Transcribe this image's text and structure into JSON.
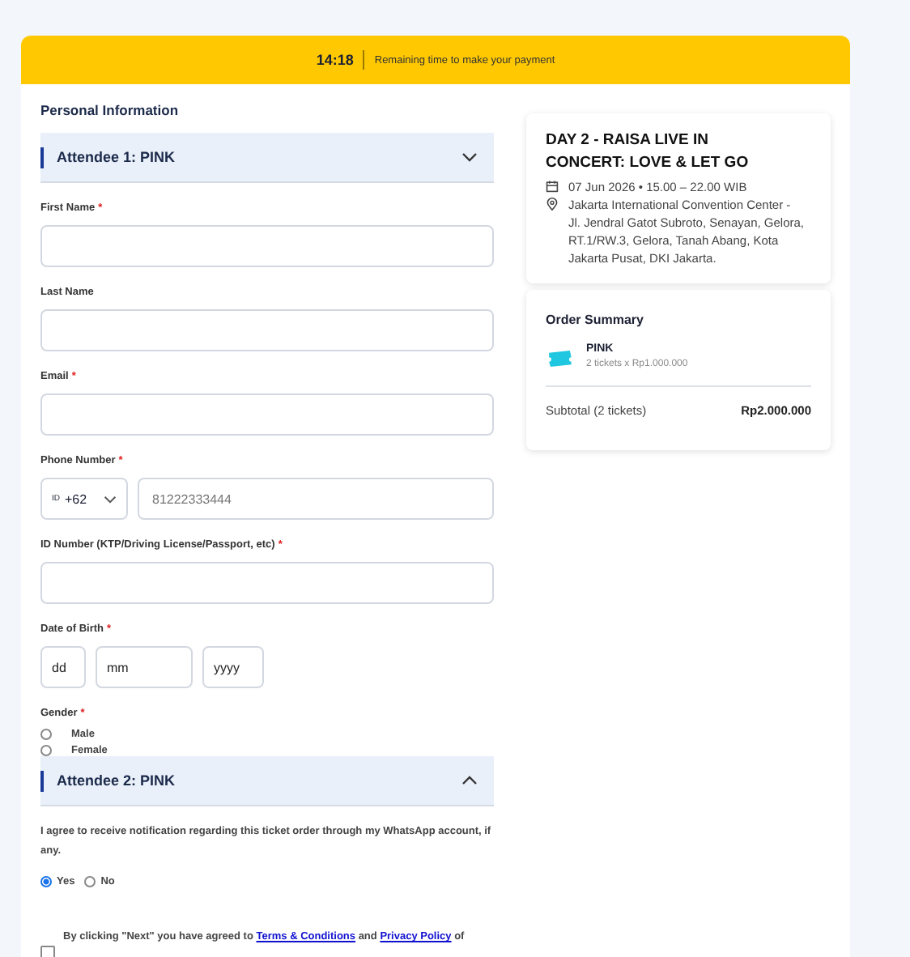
{
  "banner": {
    "timer": "14:18",
    "message": "Remaining time to make your payment"
  },
  "section_title": "Personal Information",
  "attendees": [
    {
      "title": "Attendee 1: PINK",
      "expanded": true
    },
    {
      "title": "Attendee 2: PINK",
      "expanded": false
    }
  ],
  "fields": [
    {
      "kind": "text",
      "label": "First Name",
      "required_mark": "*"
    },
    {
      "kind": "text",
      "label": "Last Name"
    },
    {
      "kind": "text",
      "label": "Email",
      "required_mark": "*"
    },
    {
      "kind": "phone",
      "label": "Phone Number",
      "required_mark": "*",
      "country": "+62",
      "flag": "ID",
      "placeholder": "81222333444"
    },
    {
      "kind": "text",
      "label": "ID Number (KTP/Driving License/Passport, etc)",
      "required_mark": "*"
    },
    {
      "kind": "date",
      "label": "Date of Birth",
      "required_mark": "*",
      "placeholders": [
        "dd",
        "mm",
        "yyyy"
      ]
    },
    {
      "kind": "radio",
      "label": "Gender",
      "required_mark": "*",
      "options": [
        {
          "label": "Male",
          "selected": false
        },
        {
          "label": "Female",
          "selected": false
        }
      ]
    }
  ],
  "whatsapp": {
    "text": "I agree to receive notification regarding this ticket order through my WhatsApp account, if any.",
    "options": [
      {
        "label": "Yes",
        "selected": true
      },
      {
        "label": "No",
        "selected": false
      }
    ]
  },
  "consent": {
    "checked": false,
    "before": "By clicking \"Next\" you have agreed to",
    "link1": "Terms & Conditions",
    "middle": "and",
    "link2": "Privacy Policy",
    "after": "of"
  },
  "event": {
    "title": "DAY 2 - RAISA LIVE IN CONCERT: LOVE & LET GO",
    "date": "07 Jun 2026 • 15.00 – 22.00 WIB",
    "venue": "Jakarta International Convention Center - Jl. Jendral Gatot Subroto, Senayan, Gelora, RT.1/RW.3, Gelora, Tanah Abang, Kota Jakarta Pusat, DKI Jakarta."
  },
  "summary": {
    "title": "Order Summary",
    "items": [
      {
        "name": "PINK",
        "detail": "2 tickets x Rp1.000.000"
      }
    ],
    "subtotal_label": "Subtotal (2 tickets)",
    "subtotal": "Rp2.000.000"
  }
}
